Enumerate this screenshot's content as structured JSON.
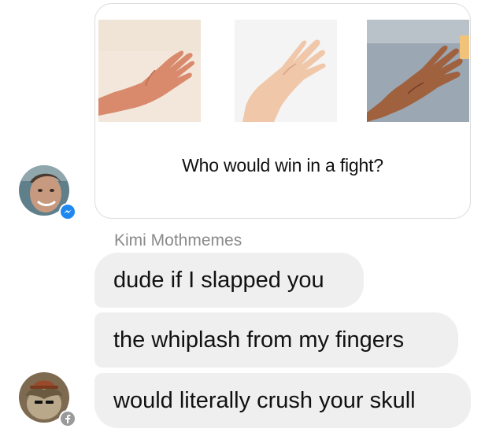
{
  "shared_card": {
    "caption": "Who would win in a fight?",
    "images": [
      {
        "icon": "hand-photo-icon"
      },
      {
        "icon": "hand-photo-icon"
      },
      {
        "icon": "hand-photo-icon"
      }
    ]
  },
  "avatars": {
    "first": {
      "icon": "user-avatar-icon",
      "badge_icon": "messenger-badge-icon",
      "badge_color": "#1e88f0"
    },
    "second": {
      "icon": "user-avatar-icon",
      "badge_icon": "facebook-badge-icon",
      "badge_color": "#9a9a9a"
    }
  },
  "messages": {
    "sender_name": "Kimi Mothmemes",
    "items": [
      {
        "text": "dude if I slapped you"
      },
      {
        "text": "the whiplash from my fingers"
      },
      {
        "text": "would literally crush your skull"
      }
    ]
  },
  "colors": {
    "bubble_bg": "#efefef",
    "sender_name": "#8a8a8a",
    "text": "#111111"
  }
}
